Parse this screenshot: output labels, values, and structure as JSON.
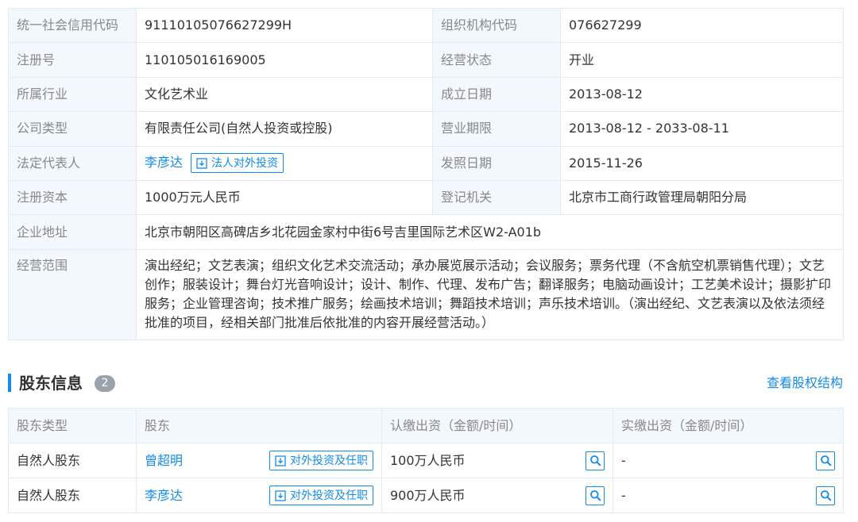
{
  "info": {
    "credit_code_label": "统一社会信用代码",
    "credit_code": "91110105076627299H",
    "org_code_label": "组织机构代码",
    "org_code": "076627299",
    "reg_no_label": "注册号",
    "reg_no": "110105016169005",
    "status_label": "经营状态",
    "status": "开业",
    "industry_label": "所属行业",
    "industry": "文化艺术业",
    "founded_label": "成立日期",
    "founded": "2013-08-12",
    "company_type_label": "公司类型",
    "company_type": "有限责任公司(自然人投资或控股)",
    "term_label": "营业期限",
    "term": "2013-08-12 - 2033-08-11",
    "legal_rep_label": "法定代表人",
    "legal_rep": "李彦达",
    "legal_rep_button": "法人对外投资",
    "issue_date_label": "发照日期",
    "issue_date": "2015-11-26",
    "capital_label": "注册资本",
    "capital": "1000万元人民币",
    "authority_label": "登记机关",
    "authority": "北京市工商行政管理局朝阳分局",
    "address_label": "企业地址",
    "address": "北京市朝阳区高碑店乡北花园金家村中街6号吉里国际艺术区W2-A01b",
    "scope_label": "经营范围",
    "scope": "演出经纪；文艺表演；组织文化艺术交流活动；承办展览展示活动；会议服务；票务代理（不含航空机票销售代理）；文艺创作；服装设计；舞台灯光音响设计；设计、制作、代理、发布广告；翻译服务；电脑动画设计；工艺美术设计；摄影扩印服务；企业管理咨询；技术推广服务；绘画技术培训；舞蹈技术培训；声乐技术培训。（演出经纪、文艺表演以及依法须经批准的项目，经相关部门批准后依批准的内容开展经营活动。）"
  },
  "shareholders": {
    "title": "股东信息",
    "count": "2",
    "view_structure": "查看股权结构",
    "columns": [
      "股东类型",
      "股东",
      "认缴出资（金额/时间）",
      "实缴出资（金额/时间）"
    ],
    "rows": [
      {
        "type": "自然人股东",
        "name": "曾超明",
        "button": "对外投资及任职",
        "subscribed": "100万人民币",
        "paid": "-"
      },
      {
        "type": "自然人股东",
        "name": "李彦达",
        "button": "对外投资及任职",
        "subscribed": "900万人民币",
        "paid": "-"
      }
    ]
  },
  "icons": {
    "invest": "invest-icon",
    "search": "search-icon"
  },
  "colors": {
    "accent": "#128bed",
    "label_bg": "#f2f8fe",
    "border": "#e4eaf2",
    "badge": "#9aa3ad"
  }
}
